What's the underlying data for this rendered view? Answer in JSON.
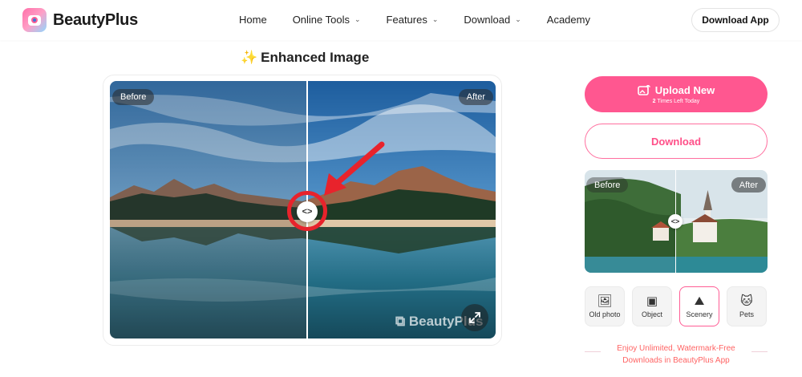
{
  "brand": {
    "name": "BeautyPlus"
  },
  "nav": [
    {
      "label": "Home",
      "dropdown": false
    },
    {
      "label": "Online Tools",
      "dropdown": true
    },
    {
      "label": "Features",
      "dropdown": true
    },
    {
      "label": "Download",
      "dropdown": true
    },
    {
      "label": "Academy",
      "dropdown": false
    }
  ],
  "header": {
    "download_app_label": "Download App"
  },
  "title": {
    "icon": "sparkle-icon",
    "text": "Enhanced Image"
  },
  "compare": {
    "before_label": "Before",
    "after_label": "After",
    "watermark": "BeautyPlus",
    "handle_glyph": "<>"
  },
  "actions": {
    "upload_label": "Upload New",
    "upload_count": "2",
    "upload_sub": " Times Left Today",
    "download_label": "Download"
  },
  "sample": {
    "before_label": "Before",
    "after_label": "After"
  },
  "categories": [
    {
      "label": "Old photo",
      "icon": "old-photo-icon",
      "active": false
    },
    {
      "label": "Object",
      "icon": "object-icon",
      "active": false
    },
    {
      "label": "Scenery",
      "icon": "scenery-icon",
      "active": true
    },
    {
      "label": "Pets",
      "icon": "pets-icon",
      "active": false
    }
  ],
  "promo": {
    "line1": "Enjoy Unlimited, Watermark-Free",
    "line2": "Downloads in  BeautyPlus App"
  },
  "colors": {
    "accent": "#ff5790",
    "annotation": "#e8232c"
  }
}
